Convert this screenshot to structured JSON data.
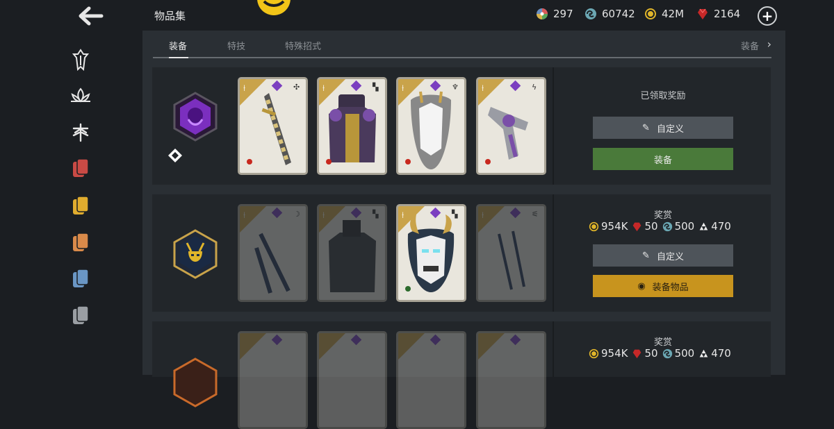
{
  "header": {
    "title": "物品集",
    "currencies": [
      {
        "icon": "rainbow-orb-icon",
        "value": "297"
      },
      {
        "icon": "steel-icon",
        "value": "60742"
      },
      {
        "icon": "coin-icon",
        "value": "42M"
      },
      {
        "icon": "ruby-icon",
        "value": "2164"
      }
    ],
    "add_icon": "plus-circle-icon"
  },
  "sidebar": {
    "items": [
      {
        "icon": "warden-class-icon"
      },
      {
        "icon": "lotus-class-icon"
      },
      {
        "icon": "dragonfly-class-icon"
      },
      {
        "icon": "red-cards-icon",
        "color": "#c94a45"
      },
      {
        "icon": "yellow-cards-icon",
        "color": "#e0ac2e"
      },
      {
        "icon": "orange-cards-icon",
        "color": "#d98a4a"
      },
      {
        "icon": "blue-cards-icon",
        "color": "#6a96c4"
      },
      {
        "icon": "gray-cards-icon",
        "color": "#9a9ea3"
      }
    ]
  },
  "tabs": [
    {
      "label": "装备",
      "active": true
    },
    {
      "label": "特技",
      "active": false
    },
    {
      "label": "特殊招式",
      "active": false
    }
  ],
  "tab_right": "装备",
  "sets": [
    {
      "badge": "purple-set-icon",
      "status": "已领取奖励",
      "customize_label": "自定义",
      "action_label": "装备",
      "action_color": "#4a7a3a"
    },
    {
      "badge": "oni-mask-set-icon",
      "reward_title": "奖赏",
      "rewards": [
        "954K",
        "50",
        "500",
        "470"
      ],
      "customize_label": "自定义",
      "action_label": "装备物品",
      "action_color": "#c8941e"
    },
    {
      "badge": "orange-set-icon",
      "reward_title": "奖赏",
      "rewards": [
        "954K",
        "50",
        "500",
        "470"
      ]
    }
  ],
  "colors": {
    "accent_gold": "#c9a34a",
    "rare_purple": "#7b3fc0",
    "panel": "#22262a"
  }
}
